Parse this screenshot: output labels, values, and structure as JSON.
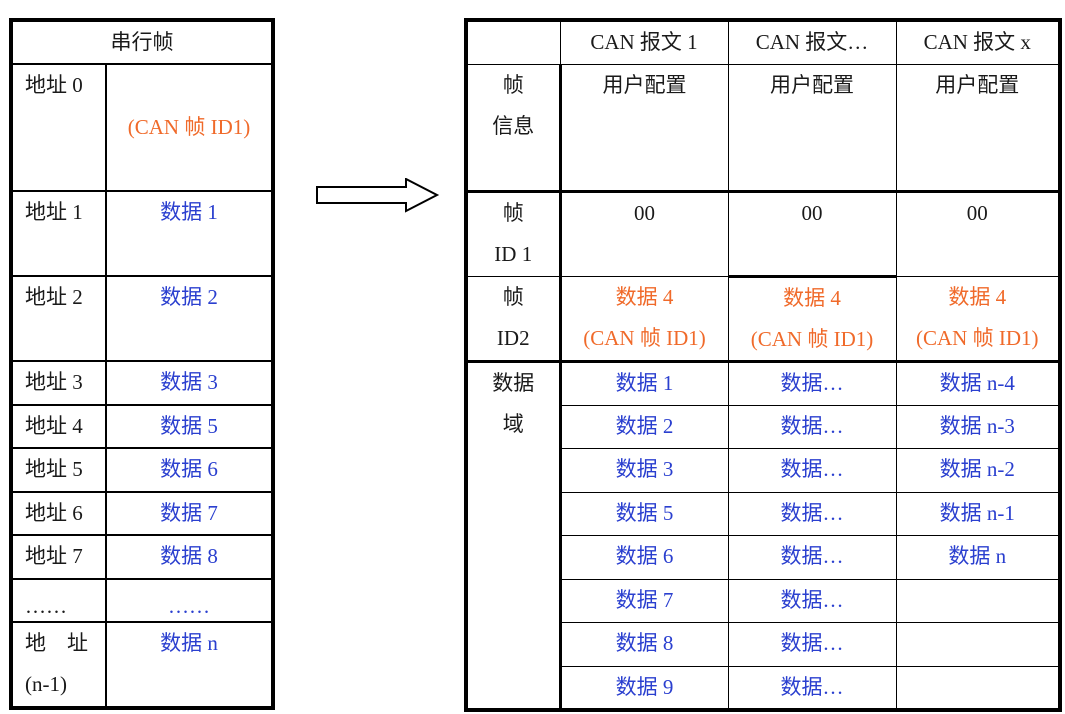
{
  "serial_frame": {
    "title": "串行帧",
    "rows": [
      {
        "address": "地址 0",
        "value": "(CAN 帧 ID1)",
        "color": "orange"
      },
      {
        "address": "地址 1",
        "value": "数据 1",
        "color": "blue"
      },
      {
        "address": "地址 2",
        "value": "数据 2",
        "color": "blue"
      },
      {
        "address": "地址 3",
        "value": "数据 3",
        "color": "blue"
      },
      {
        "address": "地址 4",
        "value": "数据 5",
        "color": "blue"
      },
      {
        "address": "地址 5",
        "value": "数据 6",
        "color": "blue"
      },
      {
        "address": "地址 6",
        "value": "数据 7",
        "color": "blue"
      },
      {
        "address": "地址 7",
        "value": "数据 8",
        "color": "blue"
      },
      {
        "address": "……",
        "value": "……",
        "color": "blue"
      },
      {
        "address_line1": "地　址",
        "address_line2": "(n-1)",
        "value": "数据 n",
        "color": "blue"
      }
    ]
  },
  "arrow": {
    "icon": "right-arrow-icon",
    "direction": "right"
  },
  "can_messages": {
    "headers": [
      "",
      "CAN 报文 1",
      "CAN 报文…",
      "CAN 报文 x"
    ],
    "frame_info": {
      "label_line1": "帧",
      "label_line2": "信息",
      "values": [
        "用户配置",
        "用户配置",
        "用户配置"
      ]
    },
    "frame_id1": {
      "label_line1": "帧",
      "label_line2": "ID 1",
      "values": [
        "00",
        "00",
        "00"
      ]
    },
    "frame_id2": {
      "label_line1": "帧",
      "label_line2": "ID2",
      "line1": "数据 4",
      "line2": "(CAN 帧 ID1)"
    },
    "data_field": {
      "label_line1": "数据",
      "label_line2": "域",
      "rows": [
        [
          "数据 1",
          "数据…",
          "数据 n-4"
        ],
        [
          "数据 2",
          "数据…",
          "数据 n-3"
        ],
        [
          "数据 3",
          "数据…",
          "数据 n-2"
        ],
        [
          "数据 5",
          "数据…",
          "数据 n-1"
        ],
        [
          "数据 6",
          "数据…",
          "数据 n"
        ],
        [
          "数据 7",
          "数据…",
          ""
        ],
        [
          "数据 8",
          "数据…",
          ""
        ],
        [
          "数据 9",
          "数据…",
          ""
        ]
      ]
    }
  },
  "colors": {
    "blue_text": "#2a3fcf",
    "orange_text": "#f06a2a",
    "border": "#000000"
  }
}
